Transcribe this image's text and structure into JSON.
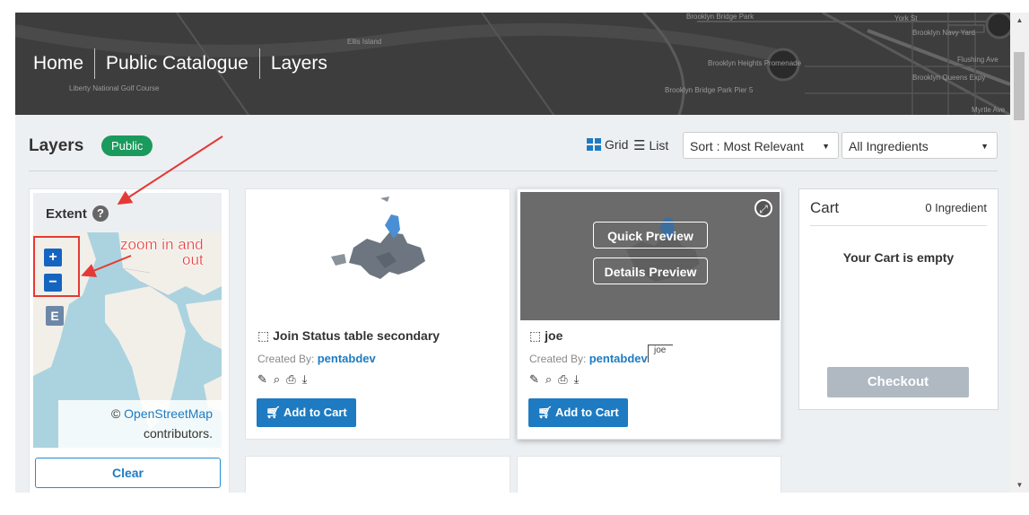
{
  "header": {
    "breadcrumbs": [
      "Home",
      "Public Catalogue",
      "Layers"
    ],
    "map_labels": [
      "Ellis Island",
      "Brooklyn Bridge Park",
      "York St",
      "Brooklyn Navy Yard",
      "Brooklyn Heights Promenade",
      "Brooklyn Bridge Park Pier 5",
      "Brooklyn Queens Expy",
      "Flushing Ave",
      "Myrtle Ave",
      "Liberty National Golf Course"
    ]
  },
  "toolbar": {
    "title": "Layers",
    "badge": "Public",
    "view_grid": "Grid",
    "view_list": "List",
    "sort_value": "Sort : Most Relevant",
    "ingredients_value": "All Ingredients"
  },
  "extent": {
    "title": "Extent",
    "zoom_in": "+",
    "zoom_out": "−",
    "extent_button": "E",
    "attribution_prefix": "©",
    "attribution_link": "OpenStreetMap",
    "attribution_suffix": "contributors.",
    "clear_label": "Clear"
  },
  "annotation": {
    "text_line1": "zoom in and",
    "text_line2": "out"
  },
  "cards": [
    {
      "title": "Join Status table secondary",
      "created_by_label": "Created By:",
      "author": "pentabdev",
      "add_to_cart": "Add to Cart"
    },
    {
      "title": "joe",
      "created_by_label": "Created By:",
      "author": "pentabdev",
      "tag": "joe",
      "quick_preview": "Quick Preview",
      "details_preview": "Details Preview",
      "add_to_cart": "Add to Cart"
    }
  ],
  "cart": {
    "title": "Cart",
    "count": "0 Ingredient",
    "empty_message": "Your Cart is empty",
    "checkout_label": "Checkout"
  },
  "colors": {
    "accent": "#1e7bc2",
    "badge_green": "#1a9a5c",
    "annotation_red": "#e53935",
    "checkout_disabled": "#b0b9c2"
  }
}
